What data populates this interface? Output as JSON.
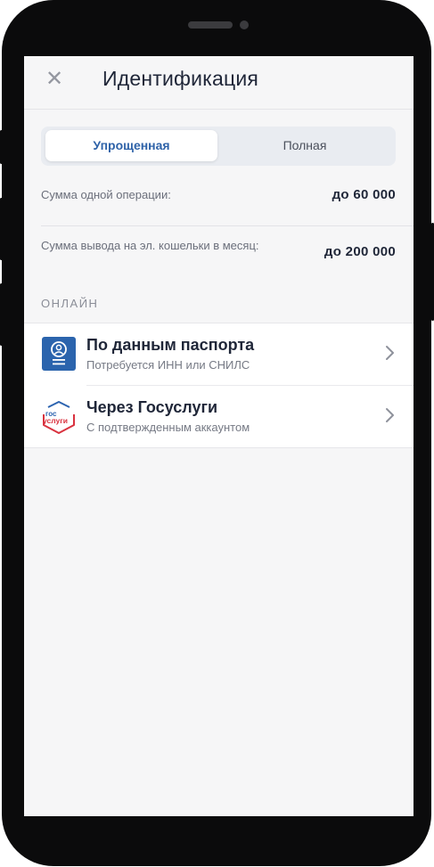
{
  "header": {
    "close_icon": "✕",
    "title": "Идентификация"
  },
  "tabs": [
    {
      "label": "Упрощенная",
      "selected": true
    },
    {
      "label": "Полная",
      "selected": false
    }
  ],
  "limits": [
    {
      "label": "Сумма одной операции:",
      "value": "до 60 000"
    },
    {
      "label": "Сумма вывода на эл. кошельки в месяц:",
      "value": "до 200 000"
    }
  ],
  "section_title": "ОНЛАЙН",
  "options": [
    {
      "title": "По данным паспорта",
      "subtitle": "Потребуется ИНН или СНИЛС",
      "icon": "passport-icon"
    },
    {
      "title": "Через Госуслуги",
      "subtitle": "С подтвержденным аккаунтом",
      "icon": "gosuslugi-icon",
      "logo_text_top": "гос",
      "logo_text_bottom": "услуги"
    }
  ],
  "colors": {
    "accent": "#2e62a8",
    "passport_blue": "#2b64ad",
    "gos_red": "#d9323f",
    "gos_blue": "#2d64b0"
  }
}
